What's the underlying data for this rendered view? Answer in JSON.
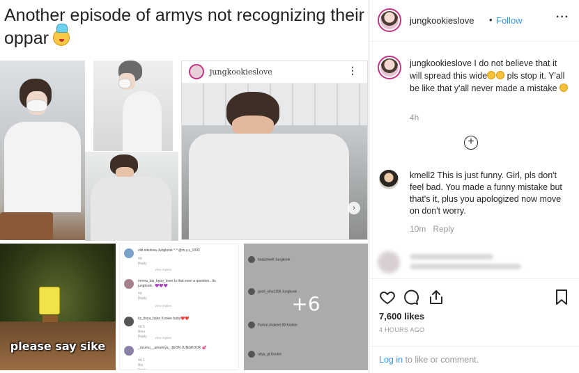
{
  "headline": {
    "line1": "Another episode of armys not recognizing their",
    "line2": "oppar"
  },
  "collage": {
    "embedded_post_username": "jungkookieslove",
    "meme_caption": "please say sike",
    "more_count": "+6",
    "screenshot_comments": [
      {
        "user": "viki.nikolova Jungkook *-* @m.y.s_1993",
        "meta": "4d  Reply",
        "avatar_color": "#7aa2c9"
      },
      {
        "user": "emma_bts_kpop_lover Is that even a question.. Its jungkook.. 💜💜💜",
        "meta": "4d  Reply",
        "avatar_color": "#a57f8b"
      },
      {
        "user": "itz_tinya_babe Kookie baby❤️❤️",
        "meta": "4d  5 likes  Reply",
        "avatar_color": "#555555"
      },
      {
        "user": "_rizumu__amamiya_ JEON JUNGKOOK 💕",
        "meta": "4d  1 like  Reply",
        "avatar_color": "#8a7fa8"
      }
    ],
    "view_replies": "View replies",
    "grey_comments": [
      "boaizewelt Jungkook",
      "gooli_sihu1108 Jungkook",
      "Farhat.shakeel.98 Kookie",
      "nitya_gt Kookie"
    ]
  },
  "header": {
    "username": "jungkookieslove",
    "separator": "•",
    "follow": "Follow",
    "more": "···"
  },
  "caption": {
    "username": "jungkookieslove",
    "text_a": " I do not believe that it will spread this wide",
    "text_b": " pls stop it. Y'all be like that y'all never made a mistake",
    "time": "4h"
  },
  "load_more": "+",
  "comment": {
    "username": "kmell2",
    "text": " This is just funny. Girl, pls don't feel bad. You made a funny mistake but that's it, plus you apologized now move on don't worry.",
    "time": "10m",
    "reply": "Reply"
  },
  "actions": {
    "likes": "7,600 likes",
    "post_time": "4 HOURS AGO",
    "login_link": "Log in",
    "login_rest": " to like or comment."
  },
  "colors": {
    "link": "#3897f0",
    "text": "#262626",
    "muted": "#999999",
    "story_ring": "#c13584"
  }
}
